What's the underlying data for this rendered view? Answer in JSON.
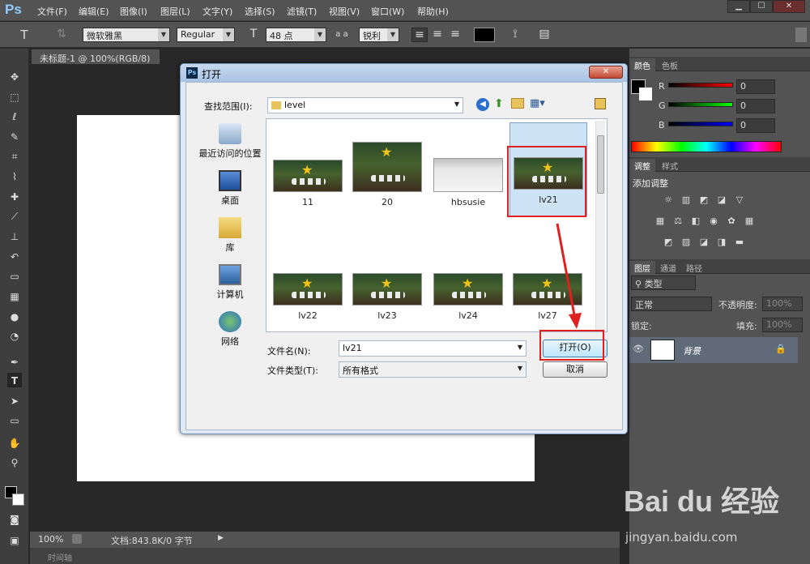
{
  "app": {
    "logo": "Ps"
  },
  "menu": [
    "文件(F)",
    "编辑(E)",
    "图像(I)",
    "图层(L)",
    "文字(Y)",
    "选择(S)",
    "滤镜(T)",
    "视图(V)",
    "窗口(W)",
    "帮助(H)"
  ],
  "options_bar": {
    "font_family": "微软雅黑",
    "font_style": "Regular",
    "font_size": "48 点",
    "aa_label": "a a",
    "antialias": "锐利",
    "text_color": "#000000"
  },
  "document": {
    "tab": "未标题-1 @ 100%(RGB/8)",
    "zoom": "100%",
    "doc_info": "文档:843.8K/0 字节",
    "timeline_label": "时间轴"
  },
  "color_panel": {
    "tabs": [
      "颜色",
      "色板"
    ],
    "channels": [
      {
        "name": "R",
        "value": "0"
      },
      {
        "name": "G",
        "value": "0"
      },
      {
        "name": "B",
        "value": "0"
      }
    ]
  },
  "adjust_panel": {
    "tabs": [
      "调整",
      "样式"
    ],
    "title": "添加调整"
  },
  "layers_panel": {
    "tabs": [
      "图层",
      "通道",
      "路径"
    ],
    "filter": "类型",
    "blend": "正常",
    "opacity_label": "不透明度:",
    "opacity": "100%",
    "lock_label": "锁定:",
    "fill_label": "填充:",
    "fill": "100%",
    "layer_name": "背景"
  },
  "dialog": {
    "title": "打开",
    "look_in_label": "查找范围(I):",
    "look_in_value": "level",
    "places": [
      "最近访问的位置",
      "桌面",
      "库",
      "计算机",
      "网络"
    ],
    "files": [
      "11",
      "20",
      "hbsusie",
      "lv21",
      "lv22",
      "lv23",
      "lv24",
      "lv27"
    ],
    "filename_label": "文件名(N):",
    "filename_value": "lv21",
    "filetype_label": "文件类型(T):",
    "filetype_value": "所有格式",
    "open_button": "打开(O)",
    "cancel_button": "取消"
  },
  "watermark": {
    "brand": "Bai du 经验",
    "url": "jingyan.baidu.com"
  },
  "colors": {
    "ps_blue": "#8ecbff",
    "highlight": "#e02020",
    "chrome": "#535353"
  }
}
